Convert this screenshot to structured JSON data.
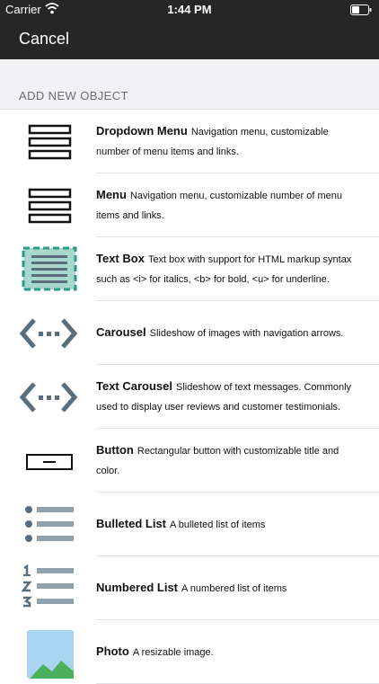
{
  "status_bar": {
    "carrier": "Carrier",
    "time": "1:44 PM"
  },
  "nav": {
    "cancel_label": "Cancel"
  },
  "section": {
    "title": "ADD NEW OBJECT"
  },
  "colors": {
    "nav_bar": "#262626",
    "icon_slate": "#5a6e7c",
    "icon_teal": "#2c9b86",
    "photo_sky": "#a9d4f2",
    "photo_hill": "#4caf5b"
  },
  "objects": [
    {
      "name": "Dropdown Menu",
      "description": "Navigation menu, customizable number of menu items and links.",
      "icon": "dropdown-menu-icon"
    },
    {
      "name": "Menu",
      "description": "Navigation menu, customizable number of menu items and links.",
      "icon": "menu-icon"
    },
    {
      "name": "Text Box",
      "description": "Text box with support for HTML markup syntax such as <i> for italics, <b> for bold, <u> for underline.",
      "icon": "text-box-icon"
    },
    {
      "name": "Carousel",
      "description": "Slideshow of images with navigation arrows.",
      "icon": "carousel-icon"
    },
    {
      "name": "Text Carousel",
      "description": "Slideshow of text messages.  Commonly used to display user reviews and customer testimonials.",
      "icon": "text-carousel-icon"
    },
    {
      "name": "Button",
      "description": "Rectangular button with customizable title and color.",
      "icon": "button-icon"
    },
    {
      "name": "Bulleted List",
      "description": "A bulleted list of items",
      "icon": "bulleted-list-icon"
    },
    {
      "name": "Numbered List",
      "description": "A numbered list of items",
      "icon": "numbered-list-icon"
    },
    {
      "name": "Photo",
      "description": "A resizable image.",
      "icon": "photo-icon"
    }
  ]
}
